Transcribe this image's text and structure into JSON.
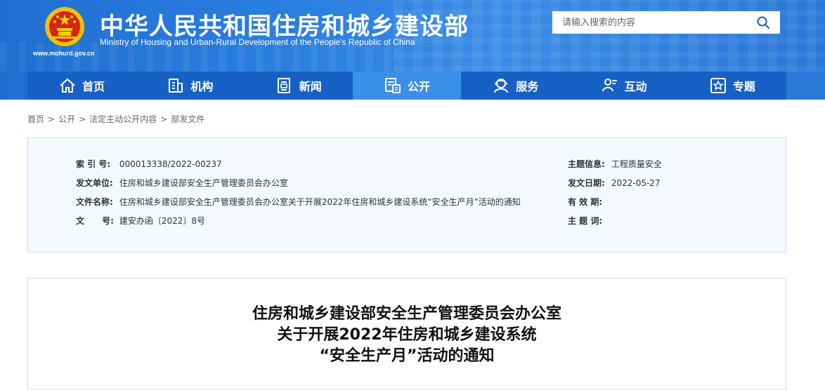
{
  "header": {
    "site_title": "中华人民共和国住房和城乡建设部",
    "site_subtitle": "Ministry of Housing and Urban-Rural Development of the People's Republic of China",
    "site_domain": "www.mohurd.gov.cn",
    "search": {
      "placeholder": "请输入搜索的内容",
      "value": ""
    },
    "brand_color": "#2b7fe0"
  },
  "nav": {
    "items": [
      {
        "label": "首页",
        "icon": "home-icon",
        "active": false
      },
      {
        "label": "机构",
        "icon": "building-icon",
        "active": false
      },
      {
        "label": "新闻",
        "icon": "newspaper-icon",
        "active": false
      },
      {
        "label": "公开",
        "icon": "document-icon",
        "active": true
      },
      {
        "label": "服务",
        "icon": "service-icon",
        "active": false
      },
      {
        "label": "互动",
        "icon": "people-icon",
        "active": false
      },
      {
        "label": "专题",
        "icon": "star-icon",
        "active": false
      }
    ],
    "bar_color": "#1761c4",
    "active_color": "#3b8fe8"
  },
  "breadcrumb": [
    "首页",
    "公开",
    "法定主动公开内容",
    "部发文件"
  ],
  "info": {
    "index_no_label": "索 引 号:",
    "index_no": "000013338/2022-00237",
    "issuer_label": "发文单位:",
    "issuer": "住房和城乡建设部安全生产管理委员会办公室",
    "doc_name_label": "文件名称:",
    "doc_name": "住房和城乡建设部安全生产管理委员会办公室关于开展2022年住房和城乡建设系统“安全生产月”活动的通知",
    "doc_no_label": "文      号:",
    "doc_no": "建安办函〔2022〕8号",
    "topic_label": "主题信息:",
    "topic": "工程质量安全",
    "date_label": "发文日期:",
    "date": "2022-05-27",
    "validity_label": "有 效 期:",
    "validity": "",
    "keywords_label": "主 题 词:",
    "keywords": ""
  },
  "article": {
    "title_line1": "住房和城乡建设部安全生产管理委员会办公室",
    "title_line2": "关于开展2022年住房和城乡建设系统",
    "title_line3": "“安全生产月”活动的通知"
  }
}
